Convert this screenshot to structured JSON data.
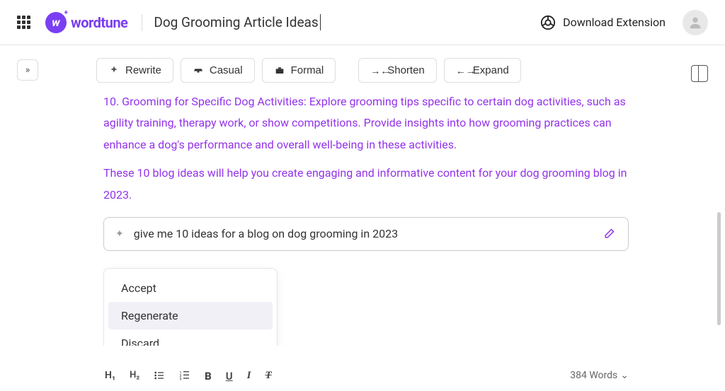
{
  "header": {
    "brand": "wordtune",
    "doc_title": "Dog Grooming Article Ideas",
    "download_label": "Download Extension"
  },
  "toolbar": {
    "rewrite": "Rewrite",
    "casual": "Casual",
    "formal": "Formal",
    "shorten": "Shorten",
    "expand": "Expand"
  },
  "content": {
    "paragraphs": [
      "10. Grooming for Specific Dog Activities: Explore grooming tips specific to certain dog activities, such as agility training, therapy work, or show competitions. Provide insights into how grooming practices can enhance a dog's performance and overall well-being in these activities.",
      "These 10 blog ideas will help you create engaging and informative content for your dog grooming blog in 2023."
    ]
  },
  "prompt": {
    "text": "give me 10 ideas for a blog on dog grooming in 2023"
  },
  "actions": {
    "accept": "Accept",
    "regenerate": "Regenerate",
    "discard": "Discard"
  },
  "footer": {
    "h1": "H₁",
    "h2": "H₂",
    "word_count": "384 Words"
  }
}
